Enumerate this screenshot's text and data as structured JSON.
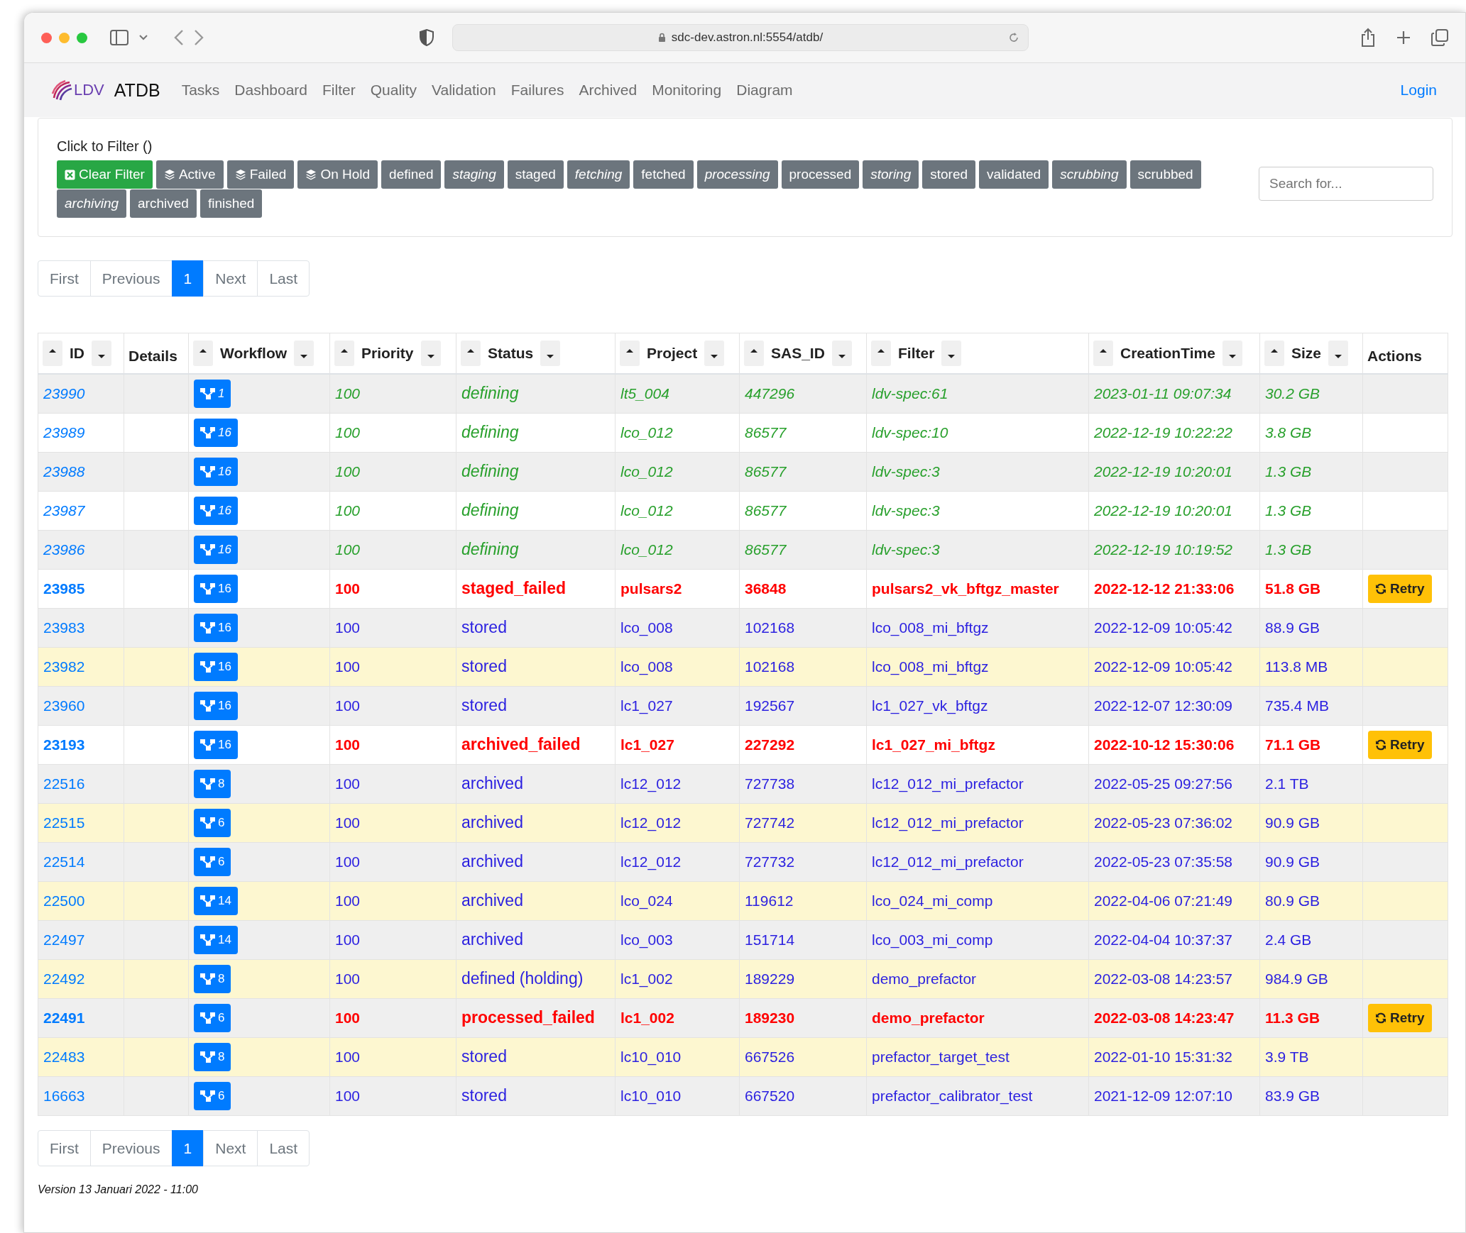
{
  "browser": {
    "url": "sdc-dev.astron.nl:5554/atdb/"
  },
  "nav": {
    "logo": "LDV",
    "brand": "ATDB",
    "items": [
      "Tasks",
      "Dashboard",
      "Filter",
      "Quality",
      "Validation",
      "Failures",
      "Archived",
      "Monitoring",
      "Diagram"
    ],
    "login": "Login"
  },
  "filter": {
    "title": "Click to Filter ()",
    "search": {
      "placeholder": "Search for..."
    },
    "buttons": [
      {
        "label": "Clear Filter",
        "kind": "clear"
      },
      {
        "label": "Active",
        "kind": "group"
      },
      {
        "label": "Failed",
        "kind": "group"
      },
      {
        "label": "On Hold",
        "kind": "group"
      },
      {
        "label": "defined",
        "kind": "status"
      },
      {
        "label": "staging",
        "kind": "transient"
      },
      {
        "label": "staged",
        "kind": "status"
      },
      {
        "label": "fetching",
        "kind": "transient"
      },
      {
        "label": "fetched",
        "kind": "status"
      },
      {
        "label": "processing",
        "kind": "transient"
      },
      {
        "label": "processed",
        "kind": "status"
      },
      {
        "label": "storing",
        "kind": "transient"
      },
      {
        "label": "stored",
        "kind": "status"
      },
      {
        "label": "validated",
        "kind": "status"
      },
      {
        "label": "scrubbing",
        "kind": "transient"
      },
      {
        "label": "scrubbed",
        "kind": "status"
      },
      {
        "label": "archiving",
        "kind": "transient"
      },
      {
        "label": "archived",
        "kind": "status"
      },
      {
        "label": "finished",
        "kind": "status"
      }
    ]
  },
  "pagination_top": [
    {
      "label": "First",
      "selected": false
    },
    {
      "label": "Previous",
      "selected": false
    },
    {
      "label": "1",
      "selected": true
    },
    {
      "label": "Next",
      "selected": false
    },
    {
      "label": "Last",
      "selected": false
    }
  ],
  "table": {
    "columns": [
      {
        "label": "ID",
        "sortable": true
      },
      {
        "label": "Details",
        "sortable": false
      },
      {
        "label": "Workflow",
        "sortable": true
      },
      {
        "label": "Priority",
        "sortable": true
      },
      {
        "label": "Status",
        "sortable": true
      },
      {
        "label": "Project",
        "sortable": true
      },
      {
        "label": "SAS_ID",
        "sortable": true
      },
      {
        "label": "Filter",
        "sortable": true
      },
      {
        "label": "CreationTime",
        "sortable": true
      },
      {
        "label": "Size",
        "sortable": true
      },
      {
        "label": "Actions",
        "sortable": false
      }
    ],
    "rows": [
      {
        "id": "23990",
        "workflow": "1",
        "priority": "100",
        "status": "defining",
        "project": "lt5_004",
        "sas_id": "447296",
        "filter": "ldv-spec:61",
        "creation_time": "2023-01-11 09:07:34",
        "size": "30.2 GB",
        "kind": "defining",
        "highlighted": false
      },
      {
        "id": "23989",
        "workflow": "16",
        "priority": "100",
        "status": "defining",
        "project": "lco_012",
        "sas_id": "86577",
        "filter": "ldv-spec:10",
        "creation_time": "2022-12-19 10:22:22",
        "size": "3.8 GB",
        "kind": "defining",
        "highlighted": false
      },
      {
        "id": "23988",
        "workflow": "16",
        "priority": "100",
        "status": "defining",
        "project": "lco_012",
        "sas_id": "86577",
        "filter": "ldv-spec:3",
        "creation_time": "2022-12-19 10:20:01",
        "size": "1.3 GB",
        "kind": "defining",
        "highlighted": false
      },
      {
        "id": "23987",
        "workflow": "16",
        "priority": "100",
        "status": "defining",
        "project": "lco_012",
        "sas_id": "86577",
        "filter": "ldv-spec:3",
        "creation_time": "2022-12-19 10:20:01",
        "size": "1.3 GB",
        "kind": "defining",
        "highlighted": false
      },
      {
        "id": "23986",
        "workflow": "16",
        "priority": "100",
        "status": "defining",
        "project": "lco_012",
        "sas_id": "86577",
        "filter": "ldv-spec:3",
        "creation_time": "2022-12-19 10:19:52",
        "size": "1.3 GB",
        "kind": "defining",
        "highlighted": false
      },
      {
        "id": "23985",
        "workflow": "16",
        "priority": "100",
        "status": "staged_failed",
        "project": "pulsars2",
        "sas_id": "36848",
        "filter": "pulsars2_vk_bftgz_master",
        "creation_time": "2022-12-12 21:33:06",
        "size": "51.8 GB",
        "kind": "failed",
        "highlighted": false,
        "action": "Retry"
      },
      {
        "id": "23983",
        "workflow": "16",
        "priority": "100",
        "status": "stored",
        "project": "lco_008",
        "sas_id": "102168",
        "filter": "lco_008_mi_bftgz",
        "creation_time": "2022-12-09 10:05:42",
        "size": "88.9 GB",
        "kind": "normal",
        "highlighted": false
      },
      {
        "id": "23982",
        "workflow": "16",
        "priority": "100",
        "status": "stored",
        "project": "lco_008",
        "sas_id": "102168",
        "filter": "lco_008_mi_bftgz",
        "creation_time": "2022-12-09 10:05:42",
        "size": "113.8 MB",
        "kind": "normal",
        "highlighted": true
      },
      {
        "id": "23960",
        "workflow": "16",
        "priority": "100",
        "status": "stored",
        "project": "lc1_027",
        "sas_id": "192567",
        "filter": "lc1_027_vk_bftgz",
        "creation_time": "2022-12-07 12:30:09",
        "size": "735.4 MB",
        "kind": "normal",
        "highlighted": false
      },
      {
        "id": "23193",
        "workflow": "16",
        "priority": "100",
        "status": "archived_failed",
        "project": "lc1_027",
        "sas_id": "227292",
        "filter": "lc1_027_mi_bftgz",
        "creation_time": "2022-10-12 15:30:06",
        "size": "71.1 GB",
        "kind": "failed",
        "highlighted": false,
        "action": "Retry"
      },
      {
        "id": "22516",
        "workflow": "8",
        "priority": "100",
        "status": "archived",
        "project": "lc12_012",
        "sas_id": "727738",
        "filter": "lc12_012_mi_prefactor",
        "creation_time": "2022-05-25 09:27:56",
        "size": "2.1 TB",
        "kind": "normal",
        "highlighted": false
      },
      {
        "id": "22515",
        "workflow": "6",
        "priority": "100",
        "status": "archived",
        "project": "lc12_012",
        "sas_id": "727742",
        "filter": "lc12_012_mi_prefactor",
        "creation_time": "2022-05-23 07:36:02",
        "size": "90.9 GB",
        "kind": "normal",
        "highlighted": true
      },
      {
        "id": "22514",
        "workflow": "6",
        "priority": "100",
        "status": "archived",
        "project": "lc12_012",
        "sas_id": "727732",
        "filter": "lc12_012_mi_prefactor",
        "creation_time": "2022-05-23 07:35:58",
        "size": "90.9 GB",
        "kind": "normal",
        "highlighted": false
      },
      {
        "id": "22500",
        "workflow": "14",
        "priority": "100",
        "status": "archived",
        "project": "lco_024",
        "sas_id": "119612",
        "filter": "lco_024_mi_comp",
        "creation_time": "2022-04-06 07:21:49",
        "size": "80.9 GB",
        "kind": "normal",
        "highlighted": true
      },
      {
        "id": "22497",
        "workflow": "14",
        "priority": "100",
        "status": "archived",
        "project": "lco_003",
        "sas_id": "151714",
        "filter": "lco_003_mi_comp",
        "creation_time": "2022-04-04 10:37:37",
        "size": "2.4 GB",
        "kind": "normal",
        "highlighted": false
      },
      {
        "id": "22492",
        "workflow": "8",
        "priority": "100",
        "status": "defined (holding)",
        "project": "lc1_002",
        "sas_id": "189229",
        "filter": "demo_prefactor",
        "creation_time": "2022-03-08 14:23:57",
        "size": "984.9 GB",
        "kind": "normal",
        "highlighted": true
      },
      {
        "id": "22491",
        "workflow": "6",
        "priority": "100",
        "status": "processed_failed",
        "project": "lc1_002",
        "sas_id": "189230",
        "filter": "demo_prefactor",
        "creation_time": "2022-03-08 14:23:47",
        "size": "11.3 GB",
        "kind": "failed",
        "highlighted": false,
        "action": "Retry"
      },
      {
        "id": "22483",
        "workflow": "8",
        "priority": "100",
        "status": "stored",
        "project": "lc10_010",
        "sas_id": "667526",
        "filter": "prefactor_target_test",
        "creation_time": "2022-01-10 15:31:32",
        "size": "3.9 TB",
        "kind": "normal",
        "highlighted": true
      },
      {
        "id": "16663",
        "workflow": "6",
        "priority": "100",
        "status": "stored",
        "project": "lc10_010",
        "sas_id": "667520",
        "filter": "prefactor_calibrator_test",
        "creation_time": "2021-12-09 12:07:10",
        "size": "83.9 GB",
        "kind": "normal",
        "highlighted": false
      }
    ]
  },
  "pagination_bottom": [
    {
      "label": "First",
      "selected": false
    },
    {
      "label": "Previous",
      "selected": false
    },
    {
      "label": "1",
      "selected": true
    },
    {
      "label": "Next",
      "selected": false
    },
    {
      "label": "Last",
      "selected": false
    }
  ],
  "version": "Version 13 Januari 2022 - 11:00"
}
